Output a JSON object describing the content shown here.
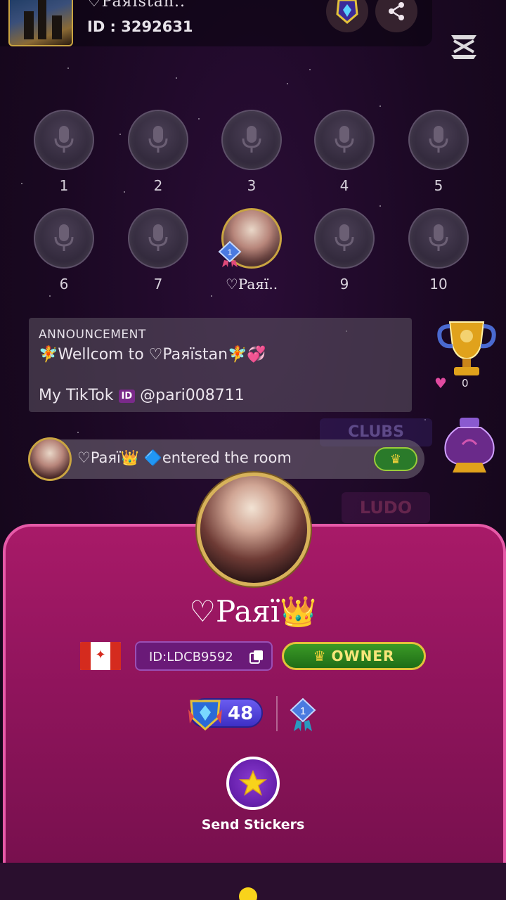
{
  "header": {
    "room_name": "♡Paяïstan..",
    "room_id": "ID : 3292631",
    "icons": [
      "room-badge-icon",
      "share-icon",
      "capcut-watermark-icon"
    ]
  },
  "seats": [
    {
      "label": "1",
      "occupied": false
    },
    {
      "label": "2",
      "occupied": false
    },
    {
      "label": "3",
      "occupied": false
    },
    {
      "label": "4",
      "occupied": false
    },
    {
      "label": "5",
      "occupied": false
    },
    {
      "label": "6",
      "occupied": false
    },
    {
      "label": "7",
      "occupied": false
    },
    {
      "label": "♡Paяï..",
      "occupied": true,
      "rank_badge": "1"
    },
    {
      "label": "9",
      "occupied": false
    },
    {
      "label": "10",
      "occupied": false
    }
  ],
  "announcement": {
    "title": "ANNOUNCEMENT",
    "line1": "🧚Wellcom to ♡Paяïstan🧚💞",
    "line2_prefix": "My TikTok",
    "line2_badge": "ID",
    "line2_handle": "@pari008711"
  },
  "side": {
    "trophy_count": "0",
    "clubs_label": "CLUBS",
    "ludo_label": "LUDO"
  },
  "entered_message": {
    "text": "♡Paяï👑 🔷entered the room"
  },
  "profile": {
    "name": "♡Paяï👑",
    "country": "Canada",
    "user_id": "ID:LDCB9592",
    "role": "OWNER",
    "level": "48",
    "rank": "1",
    "sticker_label": "Send Stickers"
  },
  "colors": {
    "background": "#1a0822",
    "card": "#a81a68",
    "card_border": "#e65aa8",
    "owner_green": "#2a8a20",
    "gold": "#c9a441",
    "sticker_purple": "#6a22b0"
  }
}
